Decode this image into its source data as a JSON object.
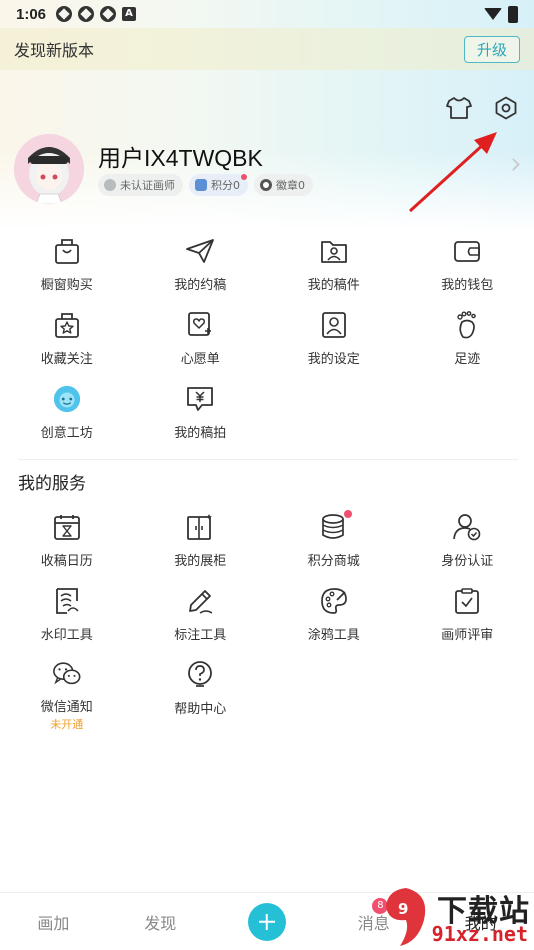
{
  "status_bar": {
    "time": "1:06",
    "notif_letter": "A"
  },
  "update_banner": {
    "text": "发现新版本",
    "button": "升级"
  },
  "profile": {
    "username": "用户IX4TWQBK",
    "badges": [
      {
        "label": "未认证画师",
        "icon": "uncertified-icon",
        "color": "#b9bcbd"
      },
      {
        "label": "积分0",
        "icon": "points-icon",
        "color": "#5b8fd6"
      },
      {
        "label": "徽章0",
        "icon": "medal-icon",
        "color": "#555555"
      }
    ]
  },
  "top_tools": {
    "theme_icon": "tshirt-icon",
    "settings_icon": "settings-hex-icon"
  },
  "menu_grid": [
    {
      "label": "橱窗购买",
      "icon": "shopping-bag-icon"
    },
    {
      "label": "我的约稿",
      "icon": "paper-plane-icon"
    },
    {
      "label": "我的稿件",
      "icon": "folder-user-icon"
    },
    {
      "label": "我的钱包",
      "icon": "wallet-icon"
    },
    {
      "label": "收藏关注",
      "icon": "bag-star-icon"
    },
    {
      "label": "心愿单",
      "icon": "heart-card-icon"
    },
    {
      "label": "我的设定",
      "icon": "portrait-icon"
    },
    {
      "label": "足迹",
      "icon": "footprint-icon"
    },
    {
      "label": "创意工坊",
      "icon": "workshop-mascot-icon"
    },
    {
      "label": "我的稿拍",
      "icon": "yen-chat-icon"
    }
  ],
  "services": {
    "title": "我的服务",
    "items": [
      {
        "label": "收稿日历",
        "icon": "calendar-hourglass-icon",
        "sub": ""
      },
      {
        "label": "我的展柜",
        "icon": "display-cabinet-icon",
        "sub": ""
      },
      {
        "label": "积分商城",
        "icon": "coin-stack-icon",
        "sub": "",
        "dot": true
      },
      {
        "label": "身份认证",
        "icon": "user-verified-icon",
        "sub": ""
      },
      {
        "label": "水印工具",
        "icon": "watermark-icon",
        "sub": ""
      },
      {
        "label": "标注工具",
        "icon": "pen-icon",
        "sub": ""
      },
      {
        "label": "涂鸦工具",
        "icon": "palette-icon",
        "sub": ""
      },
      {
        "label": "画师评审",
        "icon": "clipboard-check-icon",
        "sub": ""
      },
      {
        "label": "微信通知",
        "icon": "wechat-icon",
        "sub": "未开通"
      },
      {
        "label": "帮助中心",
        "icon": "help-icon",
        "sub": ""
      }
    ]
  },
  "bottom_nav": {
    "items": [
      {
        "label": "画加"
      },
      {
        "label": "发现"
      },
      {
        "label": ""
      },
      {
        "label": "消息",
        "badge": "8"
      },
      {
        "label": "我的"
      }
    ]
  },
  "watermark": {
    "line1": "下载站",
    "line2": "91xz.net"
  },
  "colors": {
    "accent": "#25c0d6",
    "badge_red": "#f0506e",
    "annotation_arrow": "#e02020",
    "sub_orange": "#f0a030"
  }
}
